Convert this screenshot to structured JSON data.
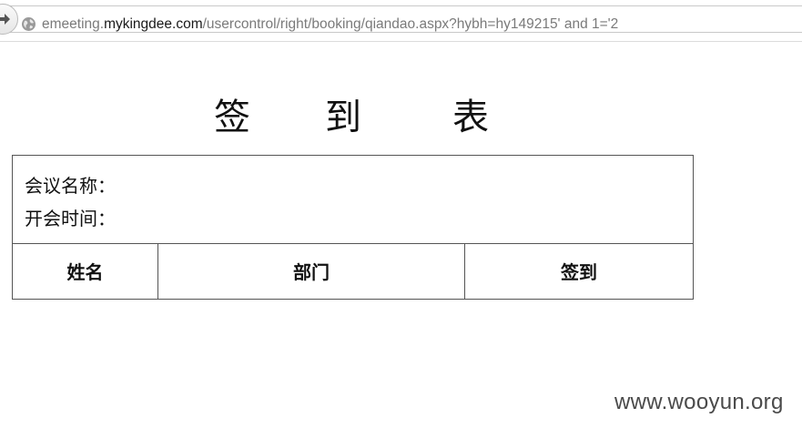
{
  "browser": {
    "url_prefix": "emeeting.",
    "url_domain": "mykingdee.com",
    "url_path": "/usercontrol/right/booking/qiandao.aspx?hybh=hy149215' and 1='2",
    "nav_icon": "forward-arrow-icon",
    "site_icon": "globe-icon"
  },
  "page": {
    "title_chars": [
      "签",
      "到",
      "表"
    ],
    "meeting_name_label": "会议名称：",
    "meeting_time_label": "开会时间：",
    "columns": [
      "姓名",
      "部门",
      "签到"
    ]
  },
  "watermark": "www.wooyun.org"
}
